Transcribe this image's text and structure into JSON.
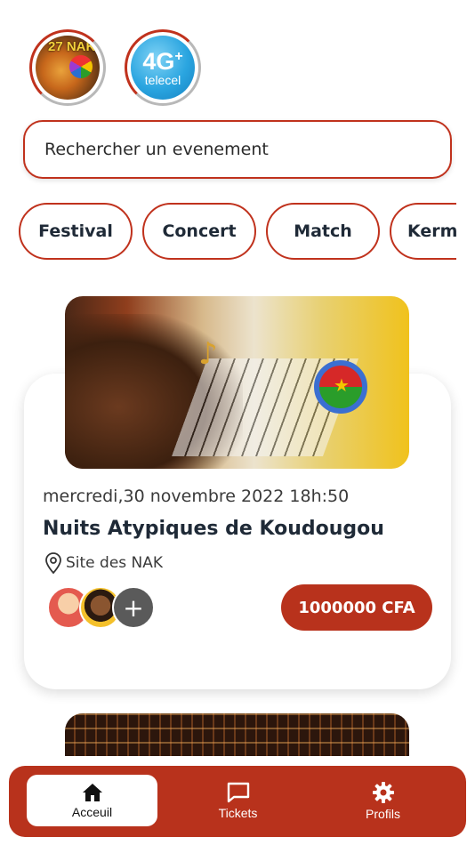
{
  "stories": [
    {
      "name": "nak-story",
      "badge": "27 NAK"
    },
    {
      "name": "telecel-story",
      "badge": "4G",
      "sub": "telecel"
    }
  ],
  "search": {
    "placeholder": "Rechercher un evenement"
  },
  "categories": [
    "Festival",
    "Concert",
    "Match",
    "Kermesse"
  ],
  "event": {
    "date": "mercredi,30 novembre 2022  18h:50",
    "title": "Nuits Atypiques de Koudougou",
    "location": "Site des NAK",
    "price": "1000000 CFA",
    "more_participants": "+"
  },
  "nav": {
    "home": "Acceuil",
    "tickets": "Tickets",
    "profile": "Profils"
  },
  "colors": {
    "accent": "#b8321c",
    "text": "#1f2a37"
  }
}
